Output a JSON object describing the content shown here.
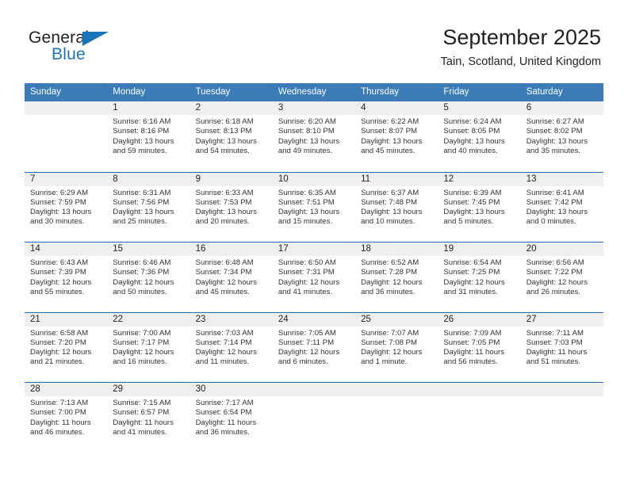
{
  "brand": {
    "name_top": "General",
    "name_bottom": "Blue",
    "triangle_color": "#1b75bb"
  },
  "header": {
    "month_title": "September 2025",
    "location": "Tain, Scotland, United Kingdom"
  },
  "theme": {
    "header_blue": "#3b7cb8",
    "row_divider_blue": "#1f6cb0",
    "day_band_gray": "#efefef",
    "text_dark": "#231f20",
    "text_body": "#333333"
  },
  "calendar": {
    "weekdays": [
      "Sunday",
      "Monday",
      "Tuesday",
      "Wednesday",
      "Thursday",
      "Friday",
      "Saturday"
    ],
    "weeks": [
      [
        {
          "day": "",
          "sunrise": "",
          "sunset": "",
          "daylight": "",
          "empty": true
        },
        {
          "day": "1",
          "sunrise": "Sunrise: 6:16 AM",
          "sunset": "Sunset: 8:16 PM",
          "daylight": "Daylight: 13 hours and 59 minutes."
        },
        {
          "day": "2",
          "sunrise": "Sunrise: 6:18 AM",
          "sunset": "Sunset: 8:13 PM",
          "daylight": "Daylight: 13 hours and 54 minutes."
        },
        {
          "day": "3",
          "sunrise": "Sunrise: 6:20 AM",
          "sunset": "Sunset: 8:10 PM",
          "daylight": "Daylight: 13 hours and 49 minutes."
        },
        {
          "day": "4",
          "sunrise": "Sunrise: 6:22 AM",
          "sunset": "Sunset: 8:07 PM",
          "daylight": "Daylight: 13 hours and 45 minutes."
        },
        {
          "day": "5",
          "sunrise": "Sunrise: 6:24 AM",
          "sunset": "Sunset: 8:05 PM",
          "daylight": "Daylight: 13 hours and 40 minutes."
        },
        {
          "day": "6",
          "sunrise": "Sunrise: 6:27 AM",
          "sunset": "Sunset: 8:02 PM",
          "daylight": "Daylight: 13 hours and 35 minutes."
        }
      ],
      [
        {
          "day": "7",
          "sunrise": "Sunrise: 6:29 AM",
          "sunset": "Sunset: 7:59 PM",
          "daylight": "Daylight: 13 hours and 30 minutes."
        },
        {
          "day": "8",
          "sunrise": "Sunrise: 6:31 AM",
          "sunset": "Sunset: 7:56 PM",
          "daylight": "Daylight: 13 hours and 25 minutes."
        },
        {
          "day": "9",
          "sunrise": "Sunrise: 6:33 AM",
          "sunset": "Sunset: 7:53 PM",
          "daylight": "Daylight: 13 hours and 20 minutes."
        },
        {
          "day": "10",
          "sunrise": "Sunrise: 6:35 AM",
          "sunset": "Sunset: 7:51 PM",
          "daylight": "Daylight: 13 hours and 15 minutes."
        },
        {
          "day": "11",
          "sunrise": "Sunrise: 6:37 AM",
          "sunset": "Sunset: 7:48 PM",
          "daylight": "Daylight: 13 hours and 10 minutes."
        },
        {
          "day": "12",
          "sunrise": "Sunrise: 6:39 AM",
          "sunset": "Sunset: 7:45 PM",
          "daylight": "Daylight: 13 hours and 5 minutes."
        },
        {
          "day": "13",
          "sunrise": "Sunrise: 6:41 AM",
          "sunset": "Sunset: 7:42 PM",
          "daylight": "Daylight: 13 hours and 0 minutes."
        }
      ],
      [
        {
          "day": "14",
          "sunrise": "Sunrise: 6:43 AM",
          "sunset": "Sunset: 7:39 PM",
          "daylight": "Daylight: 12 hours and 55 minutes."
        },
        {
          "day": "15",
          "sunrise": "Sunrise: 6:46 AM",
          "sunset": "Sunset: 7:36 PM",
          "daylight": "Daylight: 12 hours and 50 minutes."
        },
        {
          "day": "16",
          "sunrise": "Sunrise: 6:48 AM",
          "sunset": "Sunset: 7:34 PM",
          "daylight": "Daylight: 12 hours and 45 minutes."
        },
        {
          "day": "17",
          "sunrise": "Sunrise: 6:50 AM",
          "sunset": "Sunset: 7:31 PM",
          "daylight": "Daylight: 12 hours and 41 minutes."
        },
        {
          "day": "18",
          "sunrise": "Sunrise: 6:52 AM",
          "sunset": "Sunset: 7:28 PM",
          "daylight": "Daylight: 12 hours and 36 minutes."
        },
        {
          "day": "19",
          "sunrise": "Sunrise: 6:54 AM",
          "sunset": "Sunset: 7:25 PM",
          "daylight": "Daylight: 12 hours and 31 minutes."
        },
        {
          "day": "20",
          "sunrise": "Sunrise: 6:56 AM",
          "sunset": "Sunset: 7:22 PM",
          "daylight": "Daylight: 12 hours and 26 minutes."
        }
      ],
      [
        {
          "day": "21",
          "sunrise": "Sunrise: 6:58 AM",
          "sunset": "Sunset: 7:20 PM",
          "daylight": "Daylight: 12 hours and 21 minutes."
        },
        {
          "day": "22",
          "sunrise": "Sunrise: 7:00 AM",
          "sunset": "Sunset: 7:17 PM",
          "daylight": "Daylight: 12 hours and 16 minutes."
        },
        {
          "day": "23",
          "sunrise": "Sunrise: 7:03 AM",
          "sunset": "Sunset: 7:14 PM",
          "daylight": "Daylight: 12 hours and 11 minutes."
        },
        {
          "day": "24",
          "sunrise": "Sunrise: 7:05 AM",
          "sunset": "Sunset: 7:11 PM",
          "daylight": "Daylight: 12 hours and 6 minutes."
        },
        {
          "day": "25",
          "sunrise": "Sunrise: 7:07 AM",
          "sunset": "Sunset: 7:08 PM",
          "daylight": "Daylight: 12 hours and 1 minute."
        },
        {
          "day": "26",
          "sunrise": "Sunrise: 7:09 AM",
          "sunset": "Sunset: 7:05 PM",
          "daylight": "Daylight: 11 hours and 56 minutes."
        },
        {
          "day": "27",
          "sunrise": "Sunrise: 7:11 AM",
          "sunset": "Sunset: 7:03 PM",
          "daylight": "Daylight: 11 hours and 51 minutes."
        }
      ],
      [
        {
          "day": "28",
          "sunrise": "Sunrise: 7:13 AM",
          "sunset": "Sunset: 7:00 PM",
          "daylight": "Daylight: 11 hours and 46 minutes."
        },
        {
          "day": "29",
          "sunrise": "Sunrise: 7:15 AM",
          "sunset": "Sunset: 6:57 PM",
          "daylight": "Daylight: 11 hours and 41 minutes."
        },
        {
          "day": "30",
          "sunrise": "Sunrise: 7:17 AM",
          "sunset": "Sunset: 6:54 PM",
          "daylight": "Daylight: 11 hours and 36 minutes."
        },
        {
          "day": "",
          "sunrise": "",
          "sunset": "",
          "daylight": "",
          "empty": true
        },
        {
          "day": "",
          "sunrise": "",
          "sunset": "",
          "daylight": "",
          "empty": true
        },
        {
          "day": "",
          "sunrise": "",
          "sunset": "",
          "daylight": "",
          "empty": true
        },
        {
          "day": "",
          "sunrise": "",
          "sunset": "",
          "daylight": "",
          "empty": true
        }
      ]
    ]
  }
}
